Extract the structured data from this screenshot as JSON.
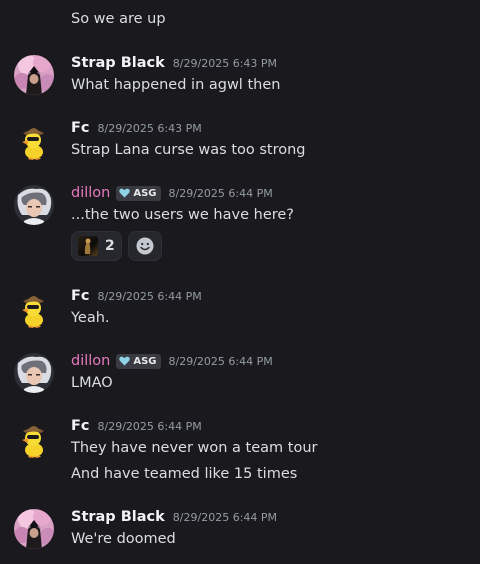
{
  "top_message": {
    "text": "So we are up"
  },
  "messages": [
    {
      "author": "Strap Black",
      "timestamp": "8/29/2025 6:43 PM",
      "lines": [
        "What happened in agwl then"
      ]
    },
    {
      "author": "Fc",
      "timestamp": "8/29/2025 6:43 PM",
      "lines": [
        "Strap Lana curse was too strong"
      ]
    },
    {
      "author": "dillon",
      "author_color": "#e879c0",
      "tag": "ASG",
      "timestamp": "8/29/2025 6:44 PM",
      "lines": [
        "...the two users we have here?"
      ],
      "reactions": [
        {
          "emoji": "custom-emoji",
          "count": "2"
        }
      ]
    },
    {
      "author": "Fc",
      "timestamp": "8/29/2025 6:44 PM",
      "lines": [
        "Yeah."
      ]
    },
    {
      "author": "dillon",
      "author_color": "#e879c0",
      "tag": "ASG",
      "timestamp": "8/29/2025 6:44 PM",
      "lines": [
        "LMAO"
      ]
    },
    {
      "author": "Fc",
      "timestamp": "8/29/2025 6:44 PM",
      "lines": [
        "They have never won a team tour",
        "And have teamed like 15 times"
      ]
    },
    {
      "author": "Strap Black",
      "timestamp": "8/29/2025 6:44 PM",
      "lines": [
        "We're doomed"
      ]
    }
  ],
  "colors": {
    "background": "#1a1a1e",
    "text": "#dbdee1",
    "timestamp": "#949ba4",
    "dillon_name": "#e879c0"
  }
}
